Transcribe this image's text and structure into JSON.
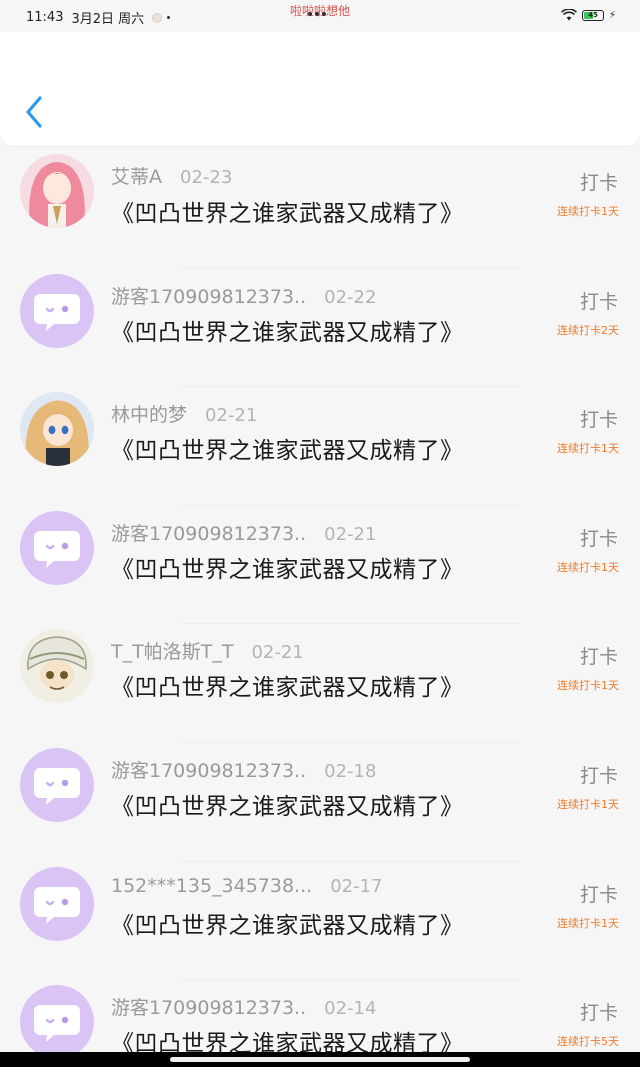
{
  "status_bar": {
    "time": "11:43",
    "date": "3月2日 周六",
    "center_text": "啦啦啦想他",
    "battery": "45"
  },
  "header": {
    "back_icon": "chevron-left-icon",
    "accent_color": "#2b9be8"
  },
  "entries": [
    {
      "username": "艾蒂A",
      "date": "02-23",
      "title": "《凹凸世界之谁家武器又成精了》",
      "checkin": "打卡",
      "streak": "连续打卡1天",
      "avatar": "anime-girl-pink"
    },
    {
      "username": "游客170909812373..",
      "date": "02-22",
      "title": "《凹凸世界之谁家武器又成精了》",
      "checkin": "打卡",
      "streak": "连续打卡2天",
      "avatar": "default-chat-bubble"
    },
    {
      "username": "林中的梦",
      "date": "02-21",
      "title": "《凹凸世界之谁家武器又成精了》",
      "checkin": "打卡",
      "streak": "连续打卡1天",
      "avatar": "anime-girl-blonde"
    },
    {
      "username": "游客170909812373..",
      "date": "02-21",
      "title": "《凹凸世界之谁家武器又成精了》",
      "checkin": "打卡",
      "streak": "连续打卡1天",
      "avatar": "default-chat-bubble"
    },
    {
      "username": "T_T帕洛斯T_T",
      "date": "02-21",
      "title": "《凹凸世界之谁家武器又成精了》",
      "checkin": "打卡",
      "streak": "连续打卡1天",
      "avatar": "anime-boy-turban"
    },
    {
      "username": "游客170909812373..",
      "date": "02-18",
      "title": "《凹凸世界之谁家武器又成精了》",
      "checkin": "打卡",
      "streak": "连续打卡1天",
      "avatar": "default-chat-bubble"
    },
    {
      "username": "152***135_345738...",
      "date": "02-17",
      "title": "《凹凸世界之谁家武器又成精了》",
      "checkin": "打卡",
      "streak": "连续打卡1天",
      "avatar": "default-chat-bubble"
    },
    {
      "username": "游客170909812373..",
      "date": "02-14",
      "title": "《凹凸世界之谁家武器又成精了》",
      "checkin": "打卡",
      "streak": "连续打卡5天",
      "avatar": "default-chat-bubble"
    }
  ],
  "colors": {
    "streak": "#f07b2a",
    "default_avatar_bg": "#d9c4f5",
    "default_avatar_fg": "#ffffff",
    "status_center": "#d9534f"
  }
}
